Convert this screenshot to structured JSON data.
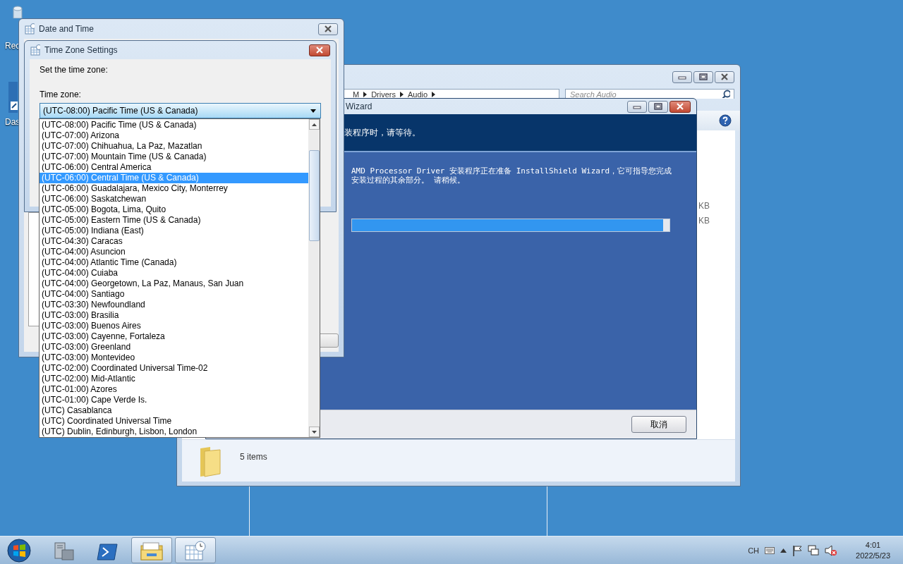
{
  "desktop_icons": [
    {
      "kind": "bin",
      "label": "Rec"
    },
    {
      "kind": "shortcut",
      "label": "Das"
    }
  ],
  "explorer": {
    "breadcrumb": [
      "M",
      "Drivers",
      "Audio"
    ],
    "search": {
      "placeholder": "Search Audio"
    },
    "size_cells": [
      "KB",
      "KB"
    ],
    "status": "5 items"
  },
  "wizard": {
    "title": "Wizard",
    "header_text": "装程序时，请等待。",
    "message": "AMD Processor Driver 安装程序正在准备 InstallShield Wizard，它可指导您完成安装过程的其余部分。 请稍候。",
    "progress": {
      "level": 0.98
    },
    "buttons": [
      "取消"
    ]
  },
  "date_time_window": {
    "title": "Date and Time"
  },
  "time_zone_dialog": {
    "title": "Time Zone Settings",
    "prompt": "Set the time zone:",
    "field_label": "Time zone:",
    "combo_value": "(UTC-08:00) Pacific Time (US & Canada)",
    "options": [
      {
        "label": "(UTC-08:00) Pacific Time (US & Canada)",
        "selected": false
      },
      {
        "label": "(UTC-07:00) Arizona",
        "selected": false
      },
      {
        "label": "(UTC-07:00) Chihuahua, La Paz, Mazatlan",
        "selected": false
      },
      {
        "label": "(UTC-07:00) Mountain Time (US & Canada)",
        "selected": false
      },
      {
        "label": "(UTC-06:00) Central America",
        "selected": false
      },
      {
        "label": "(UTC-06:00) Central Time (US & Canada)",
        "selected": true
      },
      {
        "label": "(UTC-06:00) Guadalajara, Mexico City, Monterrey",
        "selected": false
      },
      {
        "label": "(UTC-06:00) Saskatchewan",
        "selected": false
      },
      {
        "label": "(UTC-05:00) Bogota, Lima, Quito",
        "selected": false
      },
      {
        "label": "(UTC-05:00) Eastern Time (US & Canada)",
        "selected": false
      },
      {
        "label": "(UTC-05:00) Indiana (East)",
        "selected": false
      },
      {
        "label": "(UTC-04:30) Caracas",
        "selected": false
      },
      {
        "label": "(UTC-04:00) Asuncion",
        "selected": false
      },
      {
        "label": "(UTC-04:00) Atlantic Time (Canada)",
        "selected": false
      },
      {
        "label": "(UTC-04:00) Cuiaba",
        "selected": false
      },
      {
        "label": "(UTC-04:00) Georgetown, La Paz, Manaus, San Juan",
        "selected": false
      },
      {
        "label": "(UTC-04:00) Santiago",
        "selected": false
      },
      {
        "label": "(UTC-03:30) Newfoundland",
        "selected": false
      },
      {
        "label": "(UTC-03:00) Brasilia",
        "selected": false
      },
      {
        "label": "(UTC-03:00) Buenos Aires",
        "selected": false
      },
      {
        "label": "(UTC-03:00) Cayenne, Fortaleza",
        "selected": false
      },
      {
        "label": "(UTC-03:00) Greenland",
        "selected": false
      },
      {
        "label": "(UTC-03:00) Montevideo",
        "selected": false
      },
      {
        "label": "(UTC-02:00) Coordinated Universal Time-02",
        "selected": false
      },
      {
        "label": "(UTC-02:00) Mid-Atlantic",
        "selected": false
      },
      {
        "label": "(UTC-01:00) Azores",
        "selected": false
      },
      {
        "label": "(UTC-01:00) Cape Verde Is.",
        "selected": false
      },
      {
        "label": "(UTC) Casablanca",
        "selected": false
      },
      {
        "label": "(UTC) Coordinated Universal Time",
        "selected": false
      },
      {
        "label": "(UTC) Dublin, Edinburgh, Lisbon, London",
        "selected": false
      }
    ]
  },
  "taskbar": {
    "apps": [
      {
        "kind": "server",
        "active": false
      },
      {
        "kind": "powershell",
        "active": false
      },
      {
        "kind": "explorer",
        "active": true
      },
      {
        "kind": "clock",
        "active": true
      }
    ],
    "language": "CH",
    "clock_time": "4:01",
    "clock_date": "2022/5/23"
  }
}
